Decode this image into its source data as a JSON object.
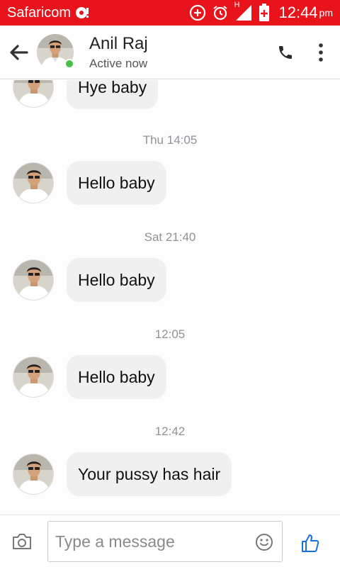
{
  "status_bar": {
    "carrier": "Safaricom",
    "network_label": "H",
    "time": "12:44",
    "ampm": "pm",
    "background_color": "#e8131b"
  },
  "header": {
    "contact_name": "Anil Raj",
    "status": "Active now",
    "online_color": "#47c041",
    "icons": [
      "back-arrow-icon",
      "phone-icon",
      "more-vertical-icon"
    ]
  },
  "messages": [
    {
      "type": "message",
      "text": "Hye baby"
    },
    {
      "type": "timestamp",
      "text": "Thu 14:05"
    },
    {
      "type": "message",
      "text": "Hello baby"
    },
    {
      "type": "timestamp",
      "text": "Sat 21:40"
    },
    {
      "type": "message",
      "text": "Hello baby"
    },
    {
      "type": "timestamp",
      "text": "12:05"
    },
    {
      "type": "message",
      "text": "Hello baby"
    },
    {
      "type": "timestamp",
      "text": "12:42"
    },
    {
      "type": "message",
      "text": "Your pussy has hair"
    }
  ],
  "composer": {
    "placeholder": "Type a message",
    "value": "",
    "icons": [
      "camera-icon",
      "emoji-icon",
      "thumbs-up-icon"
    ],
    "accent_color": "#1a6fd9"
  }
}
